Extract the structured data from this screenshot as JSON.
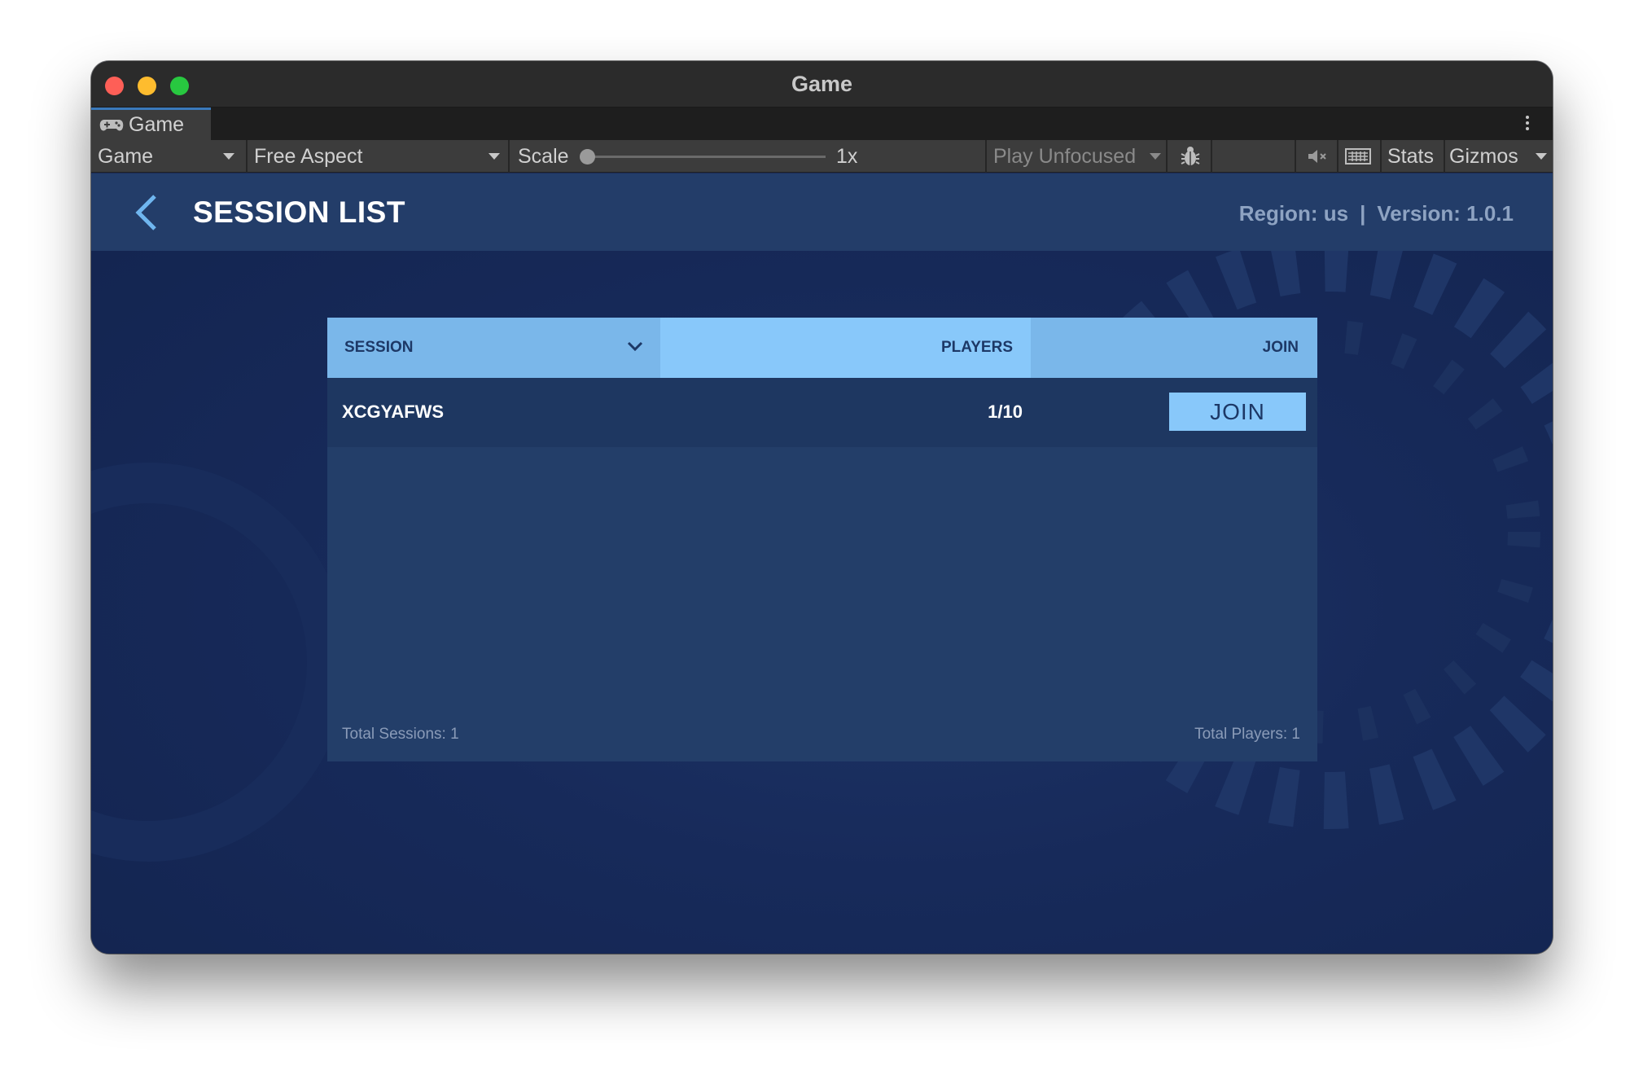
{
  "window": {
    "title": "Game"
  },
  "tab": {
    "label": "Game",
    "icon": "gamepad-icon"
  },
  "toolbar": {
    "display_dropdown": "Game",
    "aspect_dropdown": "Free Aspect",
    "scale_label": "Scale",
    "scale_value": "1x",
    "scale_fraction": 0.0,
    "play_mode_dropdown": "Play Unfocused",
    "stats_label": "Stats",
    "gizmos_label": "Gizmos",
    "icons": [
      "bug-icon",
      "mute-audio-icon",
      "keyboard-icon"
    ]
  },
  "header": {
    "title": "SESSION LIST",
    "region": "Region: us",
    "separator": "|",
    "version": "Version: 1.0.1",
    "colors": {
      "header_bg": "#233d69",
      "accent": "#88c8fa"
    }
  },
  "table": {
    "columns": [
      "SESSION",
      "PLAYERS",
      "JOIN"
    ],
    "rows": [
      {
        "session": "XCGYAFWS",
        "players": "1/10",
        "action": "JOIN"
      }
    ]
  },
  "footer": {
    "total_sessions": "Total Sessions: 1",
    "total_players": "Total Players: 1"
  }
}
